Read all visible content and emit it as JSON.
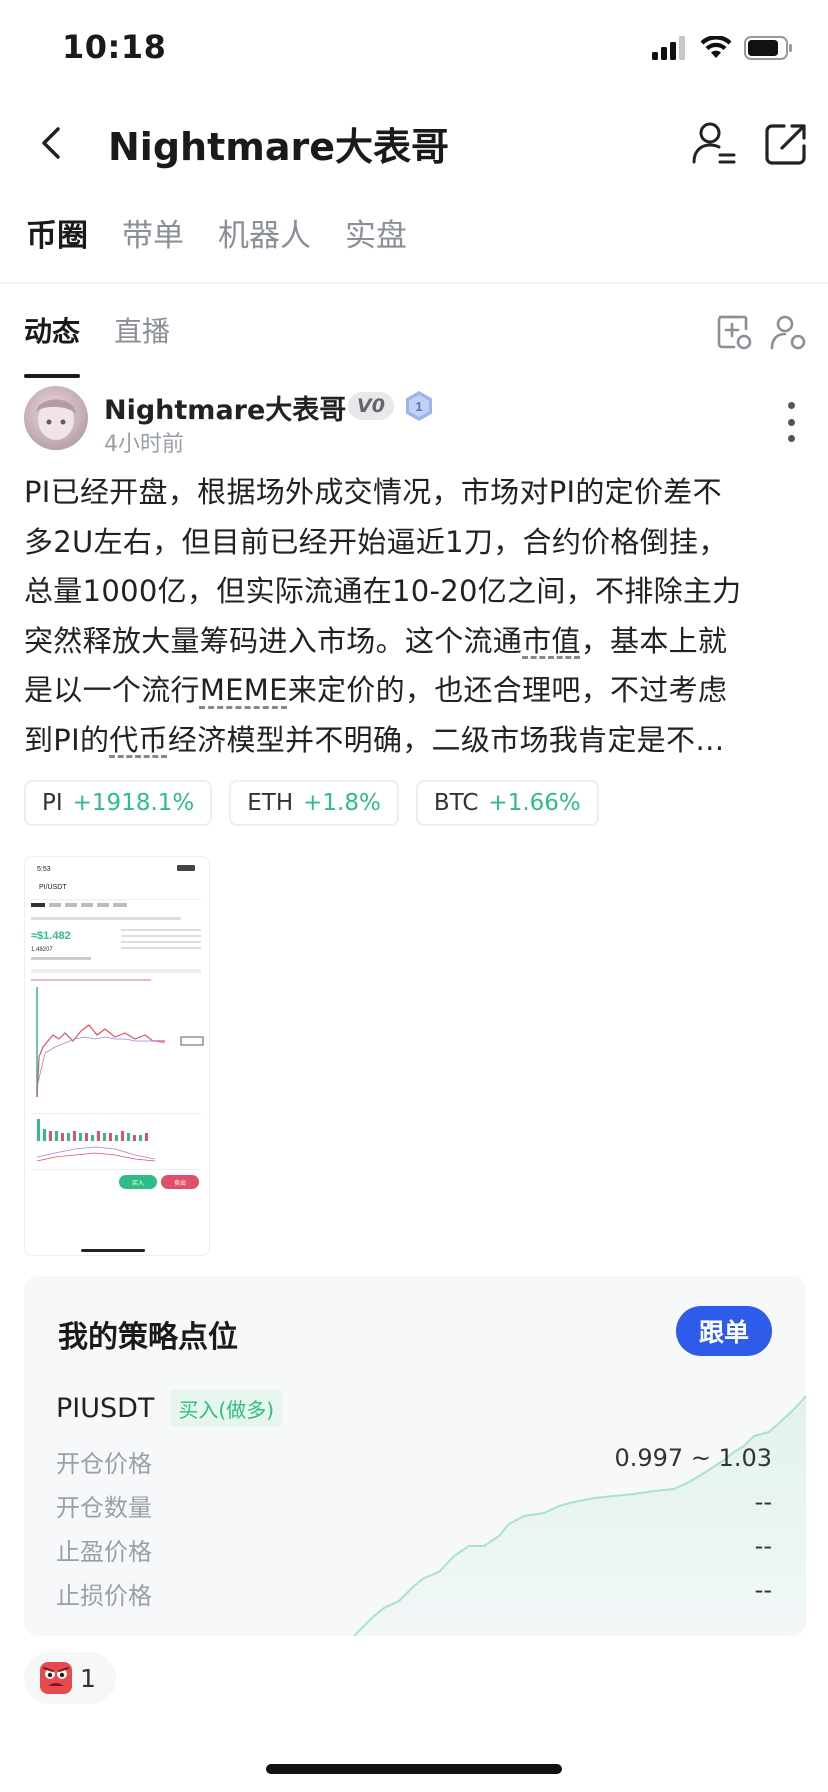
{
  "status_bar": {
    "time": "10:18"
  },
  "nav": {
    "title": "Nightmare大表哥"
  },
  "main_tabs": [
    "币圈",
    "带单",
    "机器人",
    "实盘"
  ],
  "sub_tabs": [
    "动态",
    "直播"
  ],
  "post": {
    "author": "Nightmare大表哥",
    "badge": "V0",
    "rank": "1",
    "time": "4小时前",
    "lines": [
      "PI已经开盘，根据场外成交情况，市场对PI的定价差不",
      "多2U左右，但目前已经开始逼近1刀，合约价格倒挂，",
      "总量1000亿，但实际流通在10-20亿之间，不排除主力",
      "突然释放大量筹码进入市场。这个流通",
      "市值",
      "，基本上就",
      "是以一个流行",
      "MEME",
      "来定价的，也还合理吧，不过考虑",
      "到PI的",
      "代币",
      "经济模型并不明确，二级市场我肯定是不…"
    ]
  },
  "tickers": [
    {
      "symbol": "PI",
      "change": "+1918.1%"
    },
    {
      "symbol": "ETH",
      "change": "+1.8%"
    },
    {
      "symbol": "BTC",
      "change": "+1.66%"
    }
  ],
  "thumbnail": {
    "time": "5:53",
    "pair": "PI/USDT",
    "price": "≈$1.482",
    "price2": "1.48207",
    "buy": "买入",
    "sell": "卖出"
  },
  "strategy": {
    "title": "我的策略点位",
    "follow_label": "跟单",
    "pair": "PIUSDT",
    "side": "买入(做多)",
    "rows": [
      {
        "label": "开仓价格",
        "value": "0.997 ~ 1.03"
      },
      {
        "label": "开仓数量",
        "value": "--"
      },
      {
        "label": "止盈价格",
        "value": "--"
      },
      {
        "label": "止损价格",
        "value": "--"
      }
    ]
  },
  "reaction": {
    "count": "1"
  },
  "colors": {
    "accent": "#2f5bea",
    "up": "#2dbd85",
    "text": "#1a1a1a",
    "muted": "#8a8f98"
  }
}
